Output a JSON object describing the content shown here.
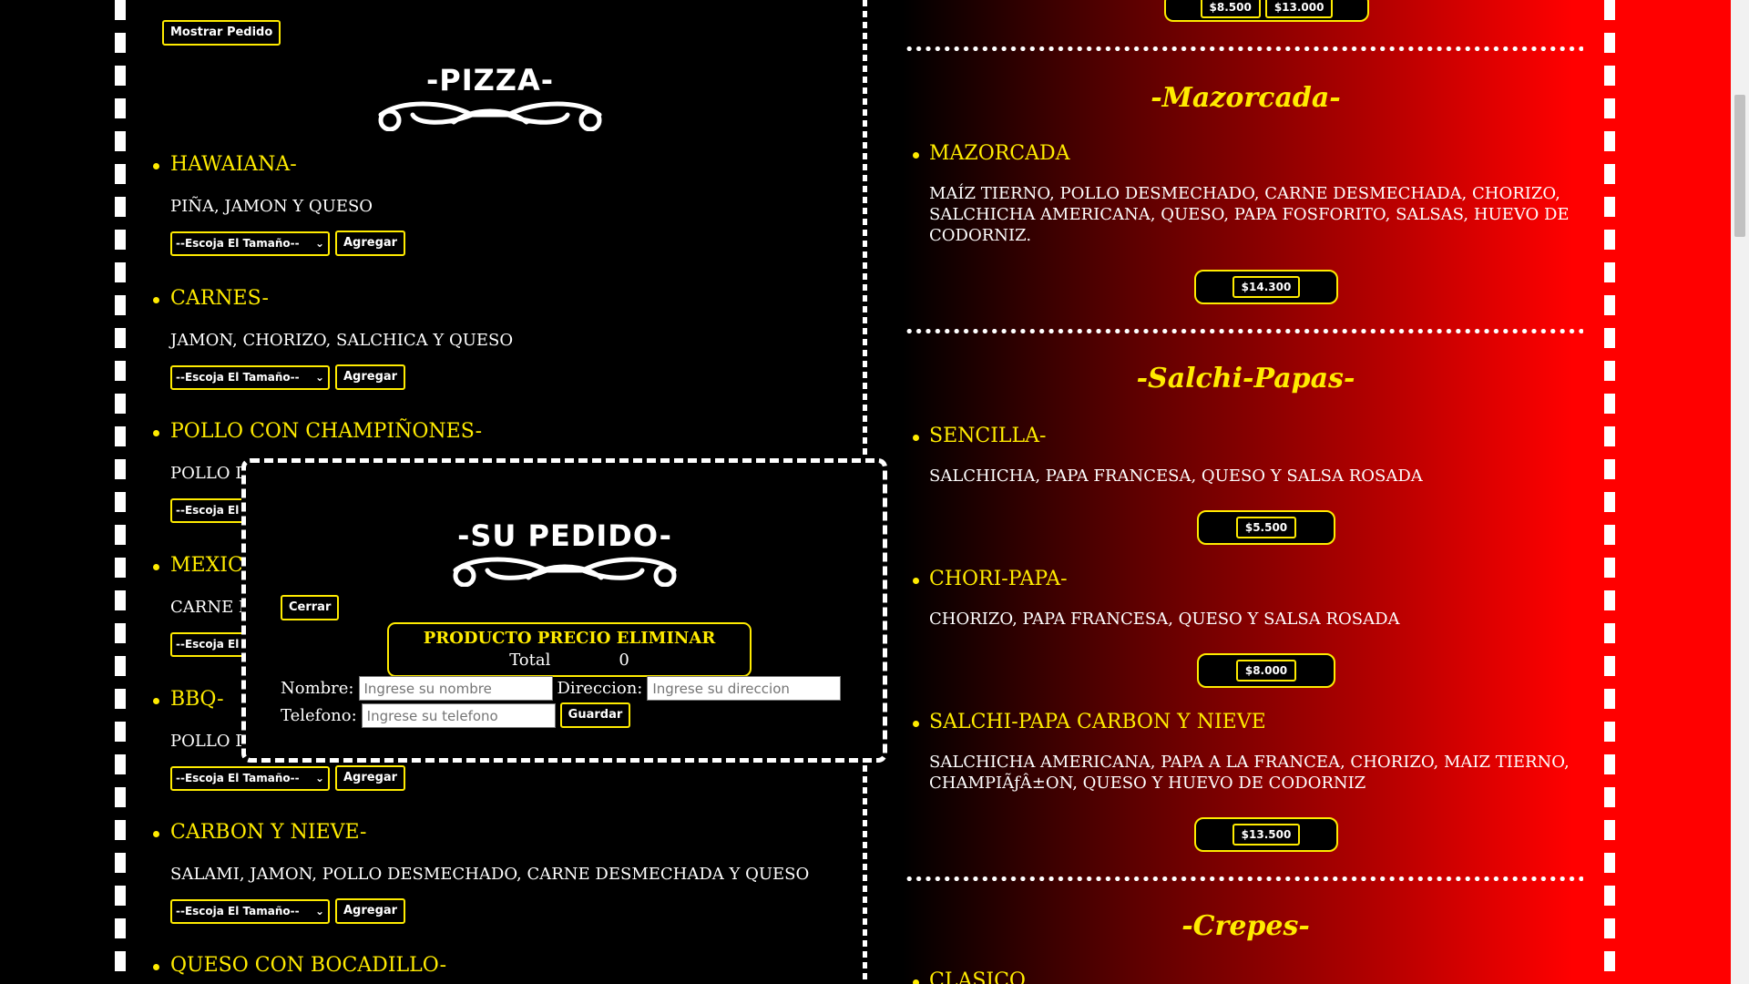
{
  "header": {
    "show_order_label": "Mostrar Pedido"
  },
  "pizza_section": {
    "title": "-PIZZA-"
  },
  "size_select_placeholder": "--Escoja El Tamaño--",
  "add_label": "Agregar",
  "pizza_items": [
    {
      "name": "HAWAIANA-",
      "desc": "PIÑA, JAMON Y QUESO"
    },
    {
      "name": "CARNES-",
      "desc": "JAMON, CHORIZO, SALCHICA Y QUESO"
    },
    {
      "name": "POLLO CON CHAMPIÑONES-",
      "desc": "POLLO D"
    },
    {
      "name": "MEXIC",
      "desc": "CARNE D"
    },
    {
      "name": "BBQ-",
      "desc": "POLLO D"
    },
    {
      "name": "CARBON Y NIEVE-",
      "desc": "SALAMI, JAMON, POLLO DESMECHADO, CARNE DESMECHADA Y QUESO"
    },
    {
      "name": "QUESO CON BOCADILLO-",
      "desc": ""
    }
  ],
  "right_menu": {
    "top_prices": [
      "$8.500",
      "$13.000"
    ],
    "mazorcada": {
      "title": "-Mazorcada-",
      "items": [
        {
          "name": "MAZORCADA",
          "desc": "MAÍZ TIERNO, POLLO DESMECHADO, CARNE DESMECHADA, CHORIZO, SALCHICHA AMERICANA, QUESO, PAPA FOSFORITO, SALSAS, HUEVO DE CODORNIZ.",
          "price": "$14.300"
        }
      ]
    },
    "salchipapas": {
      "title": "-Salchi-Papas-",
      "items": [
        {
          "name": "SENCILLA-",
          "desc": "SALCHICHA, PAPA FRANCESA, QUESO Y SALSA ROSADA",
          "price": "$5.500"
        },
        {
          "name": "CHORI-PAPA-",
          "desc": "CHORIZO, PAPA FRANCESA, QUESO Y SALSA ROSADA",
          "price": "$8.000"
        },
        {
          "name": "SALCHI-PAPA CARBON Y NIEVE",
          "desc": "SALCHICHA AMERICANA, PAPA A LA FRANCEA, CHORIZO, MAIZ TIERNO, CHAMPIÃƒÂ±ON, QUESO Y HUEVO DE CODORNIZ",
          "price": "$13.500"
        }
      ]
    },
    "crepes": {
      "title": "-Crepes-",
      "items": [
        {
          "name": "CLASICO"
        }
      ]
    }
  },
  "order_modal": {
    "title": "-SU PEDIDO-",
    "close_label": "Cerrar",
    "table_header": "PRODUCTO PRECIO ELIMINAR",
    "total_label": "Total",
    "total_value": "0",
    "name_label": "Nombre:",
    "name_placeholder": "Ingrese su nombre",
    "address_label": "Direccion:",
    "address_placeholder": "Ingrese su direccion",
    "phone_label": "Telefono:",
    "phone_placeholder": "Ingrese su telefono",
    "save_label": "Guardar"
  }
}
